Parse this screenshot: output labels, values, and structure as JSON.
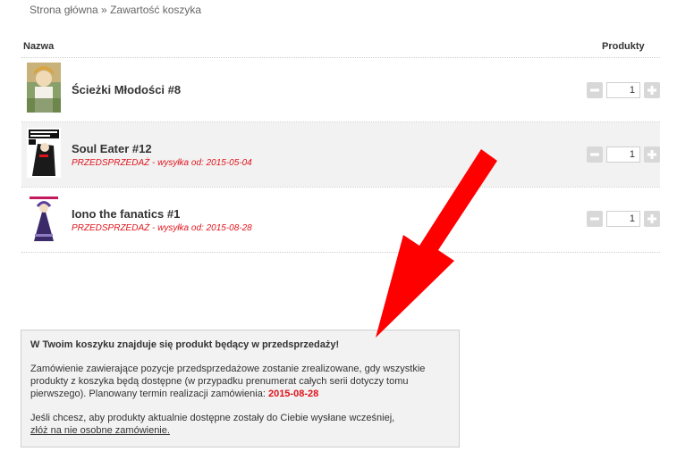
{
  "breadcrumb": {
    "home": "Strona główna",
    "separator": " » ",
    "current": "Zawartość koszyka"
  },
  "table": {
    "col_name": "Nazwa",
    "col_products": "Produkty"
  },
  "items": [
    {
      "title": "Ścieżki Młodości #8",
      "presale": "",
      "quantity": "1"
    },
    {
      "title": "Soul Eater #12",
      "presale": "PRZEDSPRZEDAŻ - wysyłka od: 2015-05-04",
      "quantity": "1"
    },
    {
      "title": "Iono the fanatics #1",
      "presale": "PRZEDSPRZEDAŻ - wysyłka od: 2015-08-28",
      "quantity": "1"
    }
  ],
  "notice": {
    "heading": "W Twoim koszyku znajduje się produkt będący w przedsprzedaży!",
    "body": "Zamówienie zawierające pozycje przedsprzedażowe zostanie zrealizowane, gdy wszystkie produkty z koszyka będą dostępne (w przypadku prenumerat całych serii dotyczy tomu pierwszego). Planowany termin realizacji zamówienia: ",
    "date": "2015-08-28",
    "option_text": "Jeśli chcesz, aby produkty aktualnie dostępne zostały do Ciebie wysłane wcześniej,",
    "option_link": "złóż na nie osobne zamówienie."
  },
  "colors": {
    "presale": "#e1141c",
    "arrow": "#ff0000",
    "row_alt": "#f2f2f2"
  },
  "icons": {
    "minus": "minus-icon",
    "plus": "plus-icon",
    "annotation": "red-arrow"
  }
}
